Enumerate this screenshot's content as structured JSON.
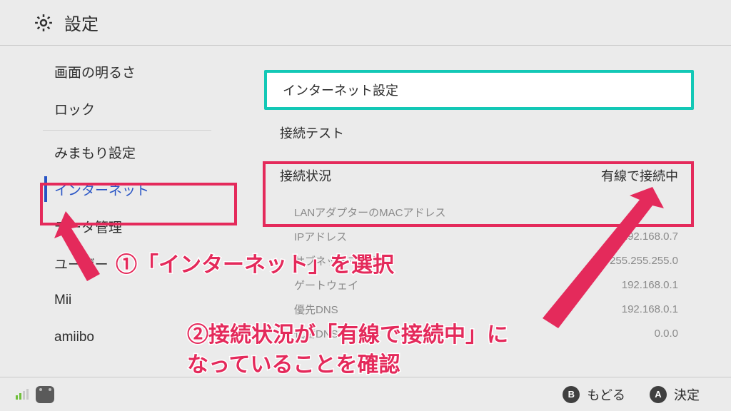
{
  "header": {
    "title": "設定"
  },
  "sidebar": {
    "items": [
      {
        "label": "画面の明るさ"
      },
      {
        "label": "ロック"
      },
      {
        "label": "みまもり設定"
      },
      {
        "label": "インターネット"
      },
      {
        "label": "データ管理"
      },
      {
        "label": "ユーザー"
      },
      {
        "label": "Mii"
      },
      {
        "label": "amiibo"
      }
    ],
    "separators_after": [
      1,
      3
    ]
  },
  "main": {
    "internet_settings": "インターネット設定",
    "connection_test": "接続テスト",
    "status_label": "接続状況",
    "status_value": "有線で接続中",
    "info": [
      {
        "k": "LANアダプターのMACアドレス",
        "v": ""
      },
      {
        "k": "IPアドレス",
        "v": "192.168.0.7"
      },
      {
        "k": "サブネットマスク",
        "v": "255.255.255.0"
      },
      {
        "k": "ゲートウェイ",
        "v": "192.168.0.1"
      },
      {
        "k": "優先DNS",
        "v": "192.168.0.1"
      },
      {
        "k": "代替DNS",
        "v": "0.0.0"
      }
    ]
  },
  "footer": {
    "back_label": "もどる",
    "ok_label": "決定",
    "b_glyph": "B",
    "a_glyph": "A"
  },
  "annotations": {
    "line1": "①「インターネット」を選択",
    "line2a": "②接続状況が「有線で接続中」に",
    "line2b": "なっていることを確認"
  }
}
